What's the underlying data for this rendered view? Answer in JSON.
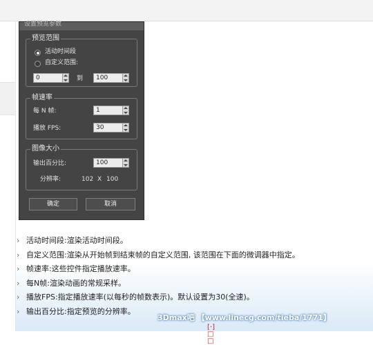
{
  "dialog": {
    "title": "设置预览参数",
    "range_group": {
      "label": "预览范围",
      "radio_active": "活动时间段",
      "radio_custom": "自定义范围:",
      "from_value": "0",
      "to_label": "到",
      "to_value": "100"
    },
    "rate_group": {
      "label": "帧速率",
      "every_n_label": "每 N 帧:",
      "every_n_value": "1",
      "fps_label": "播放 FPS:",
      "fps_value": "30"
    },
    "size_group": {
      "label": "图像大小",
      "percent_label": "输出百分比:",
      "percent_value": "100",
      "resolution_label": "分辨率:",
      "res_w": "102",
      "res_x": "X",
      "res_h": "100"
    },
    "ok_label": "确定",
    "cancel_label": "取消"
  },
  "descriptions": [
    {
      "term": "活动时间段",
      "sep": ":",
      "text": "渲染活动时间段。"
    },
    {
      "term": "自定义范围",
      "sep": ":",
      "text": "渲染从开始帧到结束帧的自定义范围, 该范围在下面的微调器中指定。"
    },
    {
      "term": "帧速率",
      "sep": ":",
      "text": "这些控件指定播放速率。"
    },
    {
      "term": "每N帧",
      "sep": ":",
      "text": "渲染动画的常规采样。"
    },
    {
      "term": "播放FPS",
      "sep": ":",
      "text": "指定播放速率(以每秒的帧数表示)。默认设置为30(全速)。"
    },
    {
      "term": "输出百分比",
      "sep": ":",
      "text": "指定预览的分辨率。"
    }
  ],
  "watermark": "3Dmax吧 【www.linecg.com/tieba/1771】",
  "bottom_fragment": "[·] □ □"
}
